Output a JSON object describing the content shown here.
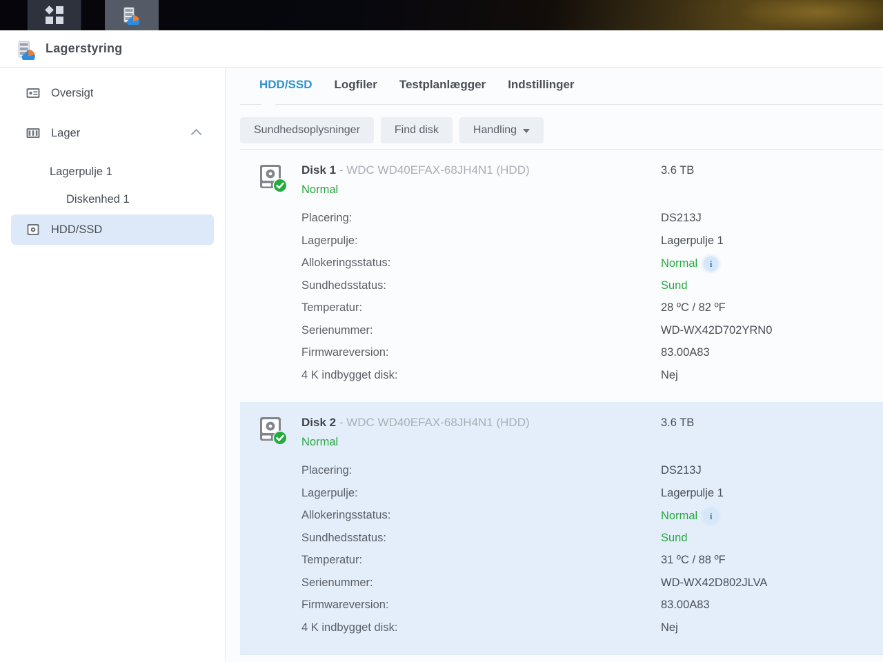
{
  "taskbar": {
    "apps_icon": "apps-grid-icon",
    "storage_icon": "storage-manager-icon"
  },
  "app": {
    "title": "Lagerstyring",
    "icon": "storage-manager-icon"
  },
  "sidebar": {
    "items": [
      {
        "label": "Oversigt",
        "icon": "dashboard-icon",
        "level": 0,
        "selected": false,
        "chevron": ""
      },
      {
        "label": "Lager",
        "icon": "storage-columns-icon",
        "level": 0,
        "selected": false,
        "chevron": "chevron-up-icon"
      },
      {
        "label": "Lagerpulje 1",
        "icon": "",
        "level": 1,
        "selected": false,
        "chevron": ""
      },
      {
        "label": "Diskenhed 1",
        "icon": "",
        "level": 2,
        "selected": false,
        "chevron": ""
      },
      {
        "label": "HDD/SSD",
        "icon": "hdd-icon",
        "level": 0,
        "selected": true,
        "chevron": ""
      }
    ]
  },
  "tabs": [
    {
      "label": "HDD/SSD",
      "active": true
    },
    {
      "label": "Logfiler",
      "active": false
    },
    {
      "label": "Testplanlægger",
      "active": false
    },
    {
      "label": "Indstillinger",
      "active": false
    }
  ],
  "toolbar": {
    "health_info": "Sundhedsoplysninger",
    "find_disk": "Find disk",
    "action": "Handling"
  },
  "disks": [
    {
      "name": "Disk 1",
      "separator": " - ",
      "model": "WDC WD40EFAX-68JH4N1 (HDD)",
      "status": "Normal",
      "capacity": "3.6 TB",
      "highlight": false,
      "fields": [
        {
          "label": "Placering:",
          "value": "DS213J",
          "green": false,
          "info": false
        },
        {
          "label": "Lagerpulje:",
          "value": "Lagerpulje 1",
          "green": false,
          "info": false
        },
        {
          "label": "Allokeringsstatus:",
          "value": "Normal",
          "green": true,
          "info": true
        },
        {
          "label": "Sundhedsstatus:",
          "value": "Sund",
          "green": true,
          "info": false
        },
        {
          "label": "Temperatur:",
          "value": "28 ºC / 82 ºF",
          "green": false,
          "info": false
        },
        {
          "label": "Serienummer:",
          "value": "WD-WX42D702YRN0",
          "green": false,
          "info": false
        },
        {
          "label": "Firmwareversion:",
          "value": "83.00A83",
          "green": false,
          "info": false
        },
        {
          "label": "4 K indbygget disk:",
          "value": "Nej",
          "green": false,
          "info": false
        }
      ]
    },
    {
      "name": "Disk 2",
      "separator": " - ",
      "model": "WDC WD40EFAX-68JH4N1 (HDD)",
      "status": "Normal",
      "capacity": "3.6 TB",
      "highlight": true,
      "fields": [
        {
          "label": "Placering:",
          "value": "DS213J",
          "green": false,
          "info": false
        },
        {
          "label": "Lagerpulje:",
          "value": "Lagerpulje 1",
          "green": false,
          "info": false
        },
        {
          "label": "Allokeringsstatus:",
          "value": "Normal",
          "green": true,
          "info": true
        },
        {
          "label": "Sundhedsstatus:",
          "value": "Sund",
          "green": true,
          "info": false
        },
        {
          "label": "Temperatur:",
          "value": "31 ºC / 88 ºF",
          "green": false,
          "info": false
        },
        {
          "label": "Serienummer:",
          "value": "WD-WX42D802JLVA",
          "green": false,
          "info": false
        },
        {
          "label": "Firmwareversion:",
          "value": "83.00A83",
          "green": false,
          "info": false
        },
        {
          "label": "4 K indbygget disk:",
          "value": "Nej",
          "green": false,
          "info": false
        }
      ]
    }
  ],
  "colors": {
    "accent": "#2d92cd",
    "status_green": "#27a93f",
    "selected_row": "#dde9f8",
    "highlight_panel": "#e4eefb",
    "text": "#4a4f57"
  },
  "info_badge_glyph": "i"
}
